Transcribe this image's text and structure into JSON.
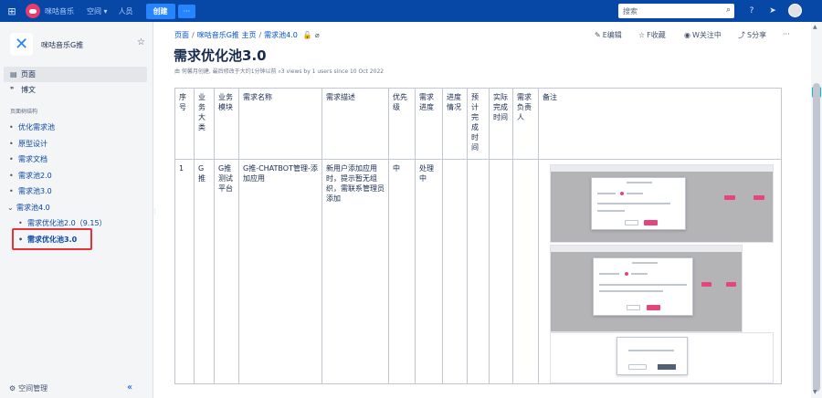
{
  "topbar": {
    "brand": "咪咕音乐",
    "nav_space": "空间",
    "nav_people": "人员",
    "create_label": "创建",
    "more_label": "···",
    "search_placeholder": "搜索"
  },
  "sidebar": {
    "space_name": "咪咕音乐G推",
    "items": [
      {
        "label": "页面"
      },
      {
        "label": "博文"
      }
    ],
    "section_label": "页面树结构",
    "tree": [
      {
        "label": "优化需求池"
      },
      {
        "label": "原型设计"
      },
      {
        "label": "需求文档"
      },
      {
        "label": "需求池2.0"
      },
      {
        "label": "需求池3.0"
      },
      {
        "label": "需求池4.0"
      }
    ],
    "subtree": [
      {
        "label": "需求优化池2.0（9.15）"
      },
      {
        "label": "需求优化池3.0"
      }
    ],
    "space_admin": "空间管理"
  },
  "breadcrumb": {
    "items": [
      "页面",
      "咪咕音乐G推 主页",
      "需求池4.0"
    ]
  },
  "actions": {
    "edit": "E编辑",
    "save": "F收藏",
    "watch": "W关注中",
    "share": "S分享",
    "more": "···"
  },
  "page": {
    "title": "需求优化池3.0",
    "byline": "由 何馨月创建, 最后修改于大约1分钟以前  ⌕3 views by 1 users since 10 Oct 2022"
  },
  "table": {
    "headers": [
      "序号",
      "业务大类",
      "业务模块",
      "需求名称",
      "需求描述",
      "优先级",
      "需求进度",
      "进度情况",
      "预计完成时间",
      "实际完成时间",
      "需求负责人",
      "备注"
    ],
    "rows": [
      {
        "cells": [
          "1",
          "G推",
          "G推测试平台",
          "G推-CHATBOT管理-添加应用",
          "新用户添加应用时，提示暂无组织，需联系管理员添加",
          "中",
          "处理中",
          "",
          "",
          "",
          "",
          ""
        ]
      }
    ]
  },
  "colors": {
    "topbar": "#0747a6",
    "accent": "#0052cc",
    "highlight": "#e5333a"
  }
}
